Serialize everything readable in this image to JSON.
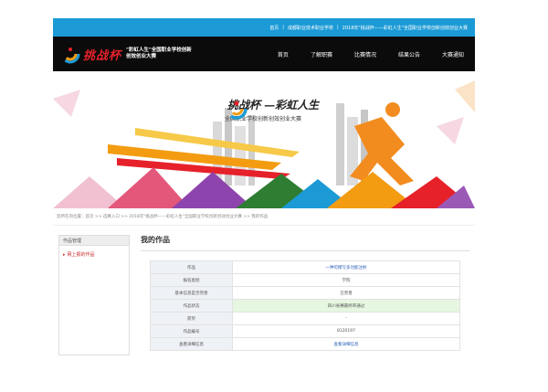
{
  "topbar": {
    "links": [
      "首页",
      "成都职业技术职业学校",
      "2018年\"挑战杯——彩虹人生\"全国职业学校创新创效创业大赛"
    ]
  },
  "header": {
    "logo_text": "挑战杯",
    "logo_sub": "\"彩虹人生\"全国职业学校创新创效创业大赛"
  },
  "menu": {
    "items": [
      "首页",
      "了解职赛",
      "比赛情况",
      "结果公告",
      "大赛通知"
    ]
  },
  "banner": {
    "title": "挑战杯 —彩虹人生",
    "subtitle": "全国职业学校创新创效创业大赛"
  },
  "breadcrumb": "您所在的位置：首页 >> 选赛入口 >> 2018年\"挑战杯——彩虹人生\"全国职业学校创新创效创业大赛 >> 我的作品",
  "sidebar": {
    "head": "作品管理",
    "item": "网上报的作品"
  },
  "main": {
    "title": "我的作品",
    "rows": [
      {
        "k": "作品",
        "v": "一种可擦写多功能注射"
      },
      {
        "k": "报名类别",
        "v": "学院"
      },
      {
        "k": "基本信息是否完善",
        "v": "已完善"
      },
      {
        "k": "作品状态",
        "v": "四川省赛最终审通过"
      },
      {
        "k": "获奖",
        "v": "-"
      },
      {
        "k": "作品编号",
        "v": "8120197"
      },
      {
        "k": "查看详细信息",
        "v": "查看详细信息"
      }
    ]
  },
  "colors": {
    "topbar": "#1b9ad6",
    "nav": "#0b0b0b",
    "accent": "#c62828",
    "highlight": "#e6f7e1"
  }
}
